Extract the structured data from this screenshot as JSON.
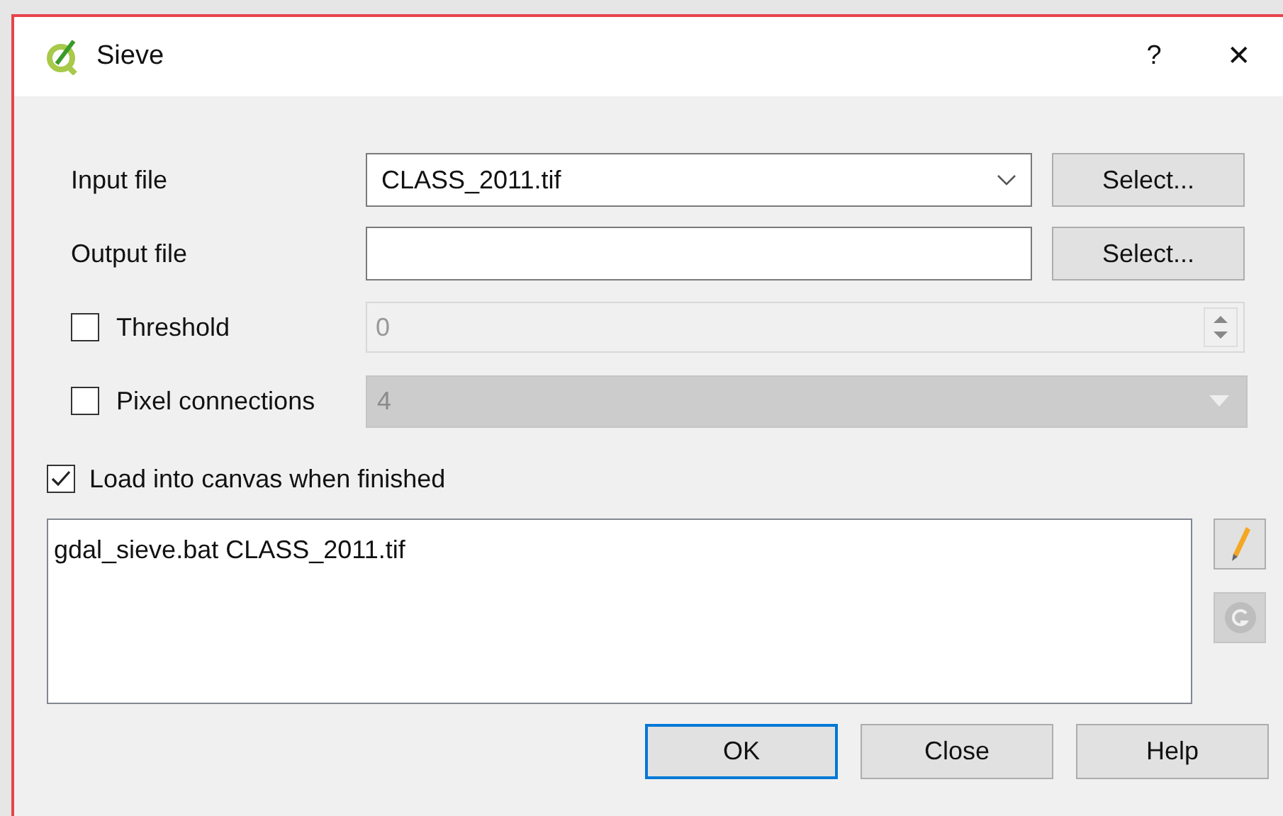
{
  "window": {
    "title": "Sieve",
    "help": "?",
    "close": "✕"
  },
  "rows": [
    {
      "kind": "combo",
      "label": "Input file",
      "value": "CLASS_2011.tif",
      "button": "Select..."
    },
    {
      "kind": "text",
      "label": "Output file",
      "value": "",
      "button": "Select..."
    },
    {
      "kind": "spin",
      "label": "Threshold",
      "checked": false,
      "value": "0",
      "disabled": true
    },
    {
      "kind": "select",
      "label": "Pixel connections",
      "checked": false,
      "value": "4",
      "disabled": true
    }
  ],
  "load": {
    "label": "Load into canvas when finished",
    "checked": true
  },
  "command": {
    "text": "gdal_sieve.bat CLASS_2011.tif",
    "edit_enabled": true,
    "reset_enabled": false
  },
  "buttons": [
    {
      "label": "OK",
      "selected": true
    },
    {
      "label": "Close",
      "selected": false
    },
    {
      "label": "Help",
      "selected": false
    }
  ]
}
